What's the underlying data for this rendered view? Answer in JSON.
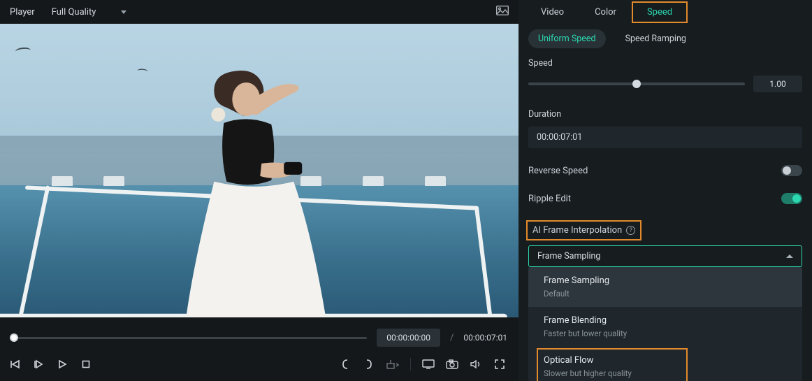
{
  "player": {
    "header_label": "Player",
    "quality": "Full Quality",
    "current_time": "00:00:00:00",
    "total_time": "00:00:07:01"
  },
  "tabs": {
    "video": "Video",
    "color": "Color",
    "speed": "Speed",
    "active": "speed"
  },
  "subtabs": {
    "uniform": "Uniform Speed",
    "ramping": "Speed Ramping"
  },
  "speed": {
    "label": "Speed",
    "value": "1.00",
    "slider_percent": 50
  },
  "duration": {
    "label": "Duration",
    "value": "00:00:07:01"
  },
  "toggles": {
    "reverse_label": "Reverse Speed",
    "reverse_on": false,
    "ripple_label": "Ripple Edit",
    "ripple_on": true
  },
  "ai": {
    "label": "AI Frame Interpolation",
    "selected": "Frame Sampling",
    "options": [
      {
        "title": "Frame Sampling",
        "subtitle": "Default"
      },
      {
        "title": "Frame Blending",
        "subtitle": "Faster but lower quality"
      },
      {
        "title": "Optical Flow",
        "subtitle": "Slower but higher quality"
      }
    ]
  },
  "icons": {
    "snapshot": "image-icon",
    "prev_frame": "prev-frame",
    "play_in": "play-in",
    "play": "play",
    "stop": "stop",
    "mark_in": "mark-in",
    "mark_out": "mark-out",
    "markers": "markers",
    "display": "display",
    "camera": "camera",
    "volume": "volume",
    "fullscreen": "fullscreen"
  }
}
